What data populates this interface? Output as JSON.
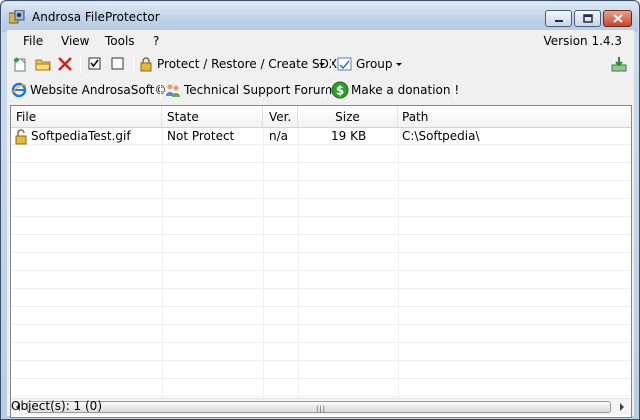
{
  "window": {
    "title": "Androsa FileProtector"
  },
  "menu": {
    "items": [
      "File",
      "View",
      "Tools",
      "?"
    ],
    "version": "Version 1.4.3"
  },
  "toolbar": {
    "add_icon": "add-file-icon",
    "folder_icon": "open-folder-icon",
    "delete_icon": "delete-icon",
    "check_all_icon": "checkbox-checked-icon",
    "uncheck_all_icon": "checkbox-empty-icon",
    "protect_label": "Protect / Restore / Create SDX",
    "group_label": "Group",
    "export_icon": "export-icon"
  },
  "links": {
    "website": "Website AndrosaSoft©",
    "forum": "Technical Support Forum",
    "donation": "Make a donation !"
  },
  "list": {
    "columns": [
      "File",
      "State",
      "Ver.",
      "Size",
      "Path"
    ],
    "rows": [
      {
        "file": "SoftpediaTest.gif",
        "state": "Not Protect",
        "ver": "n/a",
        "size": "19 KB",
        "path": "C:\\Softpedia\\"
      }
    ]
  },
  "status": {
    "text": "Object(s): 1 (0)"
  },
  "colors": {
    "titlebar": "#c3d4e9",
    "close_button": "#c4462b",
    "donation_icon": "#2e9e2e",
    "delete_icon": "#d22020"
  }
}
